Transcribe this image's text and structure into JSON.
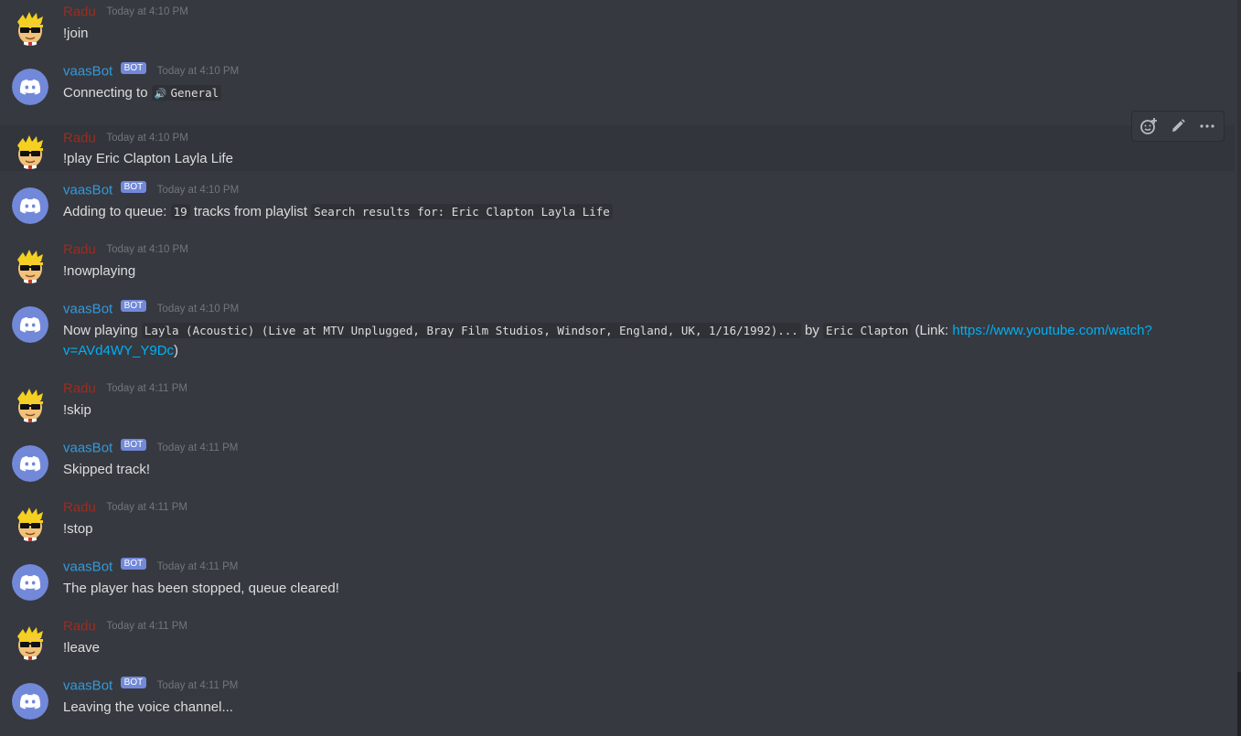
{
  "colors": {
    "background": "#36393f",
    "user_name": "#992d22",
    "bot_name": "#3498db",
    "bot_tag": "#7289da",
    "link": "#00b0f4"
  },
  "users": {
    "radu": "Radu",
    "bot": "vaasBot",
    "bot_tag": "BOT"
  },
  "messages": [
    {
      "author": "Radu",
      "time": "Today at 4:10 PM",
      "text": "!join"
    },
    {
      "author": "vaasBot",
      "time": "Today at 4:10 PM",
      "prefix": "Connecting to",
      "channel_icon": "speaker-icon",
      "channel": "General"
    },
    {
      "author": "Radu",
      "time": "Today at 4:10 PM",
      "text": "!play Eric Clapton Layla Life"
    },
    {
      "author": "vaasBot",
      "time": "Today at 4:10 PM",
      "prefix": "Adding to queue:",
      "count": "19",
      "middle": "tracks from playlist",
      "playlist": "Search results for: Eric Clapton Layla Life"
    },
    {
      "author": "Radu",
      "time": "Today at 4:10 PM",
      "text": "!nowplaying"
    },
    {
      "author": "vaasBot",
      "time": "Today at 4:10 PM",
      "prefix": "Now playing",
      "track": "Layla (Acoustic) (Live at MTV Unplugged, Bray Film Studios, Windsor, England, UK, 1/16/1992)...",
      "by": "by",
      "artist": "Eric Clapton",
      "link_open": "(Link:",
      "link": "https://www.youtube.com/watch?v=AVd4WY_Y9Dc",
      "link_close": ")"
    },
    {
      "author": "Radu",
      "time": "Today at 4:11 PM",
      "text": "!skip"
    },
    {
      "author": "vaasBot",
      "time": "Today at 4:11 PM",
      "text": "Skipped track!"
    },
    {
      "author": "Radu",
      "time": "Today at 4:11 PM",
      "text": "!stop"
    },
    {
      "author": "vaasBot",
      "time": "Today at 4:11 PM",
      "text": "The player has been stopped, queue cleared!"
    },
    {
      "author": "Radu",
      "time": "Today at 4:11 PM",
      "text": "!leave"
    },
    {
      "author": "vaasBot",
      "time": "Today at 4:11 PM",
      "text": "Leaving the voice channel..."
    }
  ],
  "toolbar": {
    "icons": [
      "add-reaction-icon",
      "edit-icon",
      "more-icon"
    ]
  }
}
